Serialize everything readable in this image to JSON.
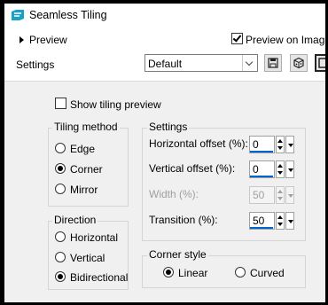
{
  "window": {
    "title": "Seamless Tiling",
    "accent": "#1ba1c6"
  },
  "header": {
    "preview_label": "Preview",
    "preview_on_image_label": "Preview on Image",
    "preview_on_image_checked": true,
    "settings_label": "Settings",
    "preset_value": "Default",
    "tools": [
      "save-icon",
      "dice-icon",
      "gear-icon"
    ]
  },
  "options": {
    "show_tiling_preview_label": "Show tiling preview",
    "show_tiling_preview_checked": false
  },
  "tiling_method": {
    "title": "Tiling method",
    "options": [
      "Edge",
      "Corner",
      "Mirror"
    ],
    "selected": "Corner"
  },
  "direction": {
    "title": "Direction",
    "options": [
      "Horizontal",
      "Vertical",
      "Bidirectional"
    ],
    "selected": "Bidirectional"
  },
  "settings": {
    "title": "Settings",
    "horizontal_offset": {
      "label": "Horizontal offset (%):",
      "value": "0",
      "fill": 0.0
    },
    "vertical_offset": {
      "label": "Vertical offset (%):",
      "value": "0",
      "fill": 0.0
    },
    "width": {
      "label": "Width (%):",
      "value": "50",
      "enabled": false
    },
    "transition": {
      "label": "Transition (%):",
      "value": "50",
      "fill": 0.5
    }
  },
  "corner_style": {
    "title": "Corner style",
    "options": [
      "Linear",
      "Curved"
    ],
    "selected": "Linear"
  }
}
